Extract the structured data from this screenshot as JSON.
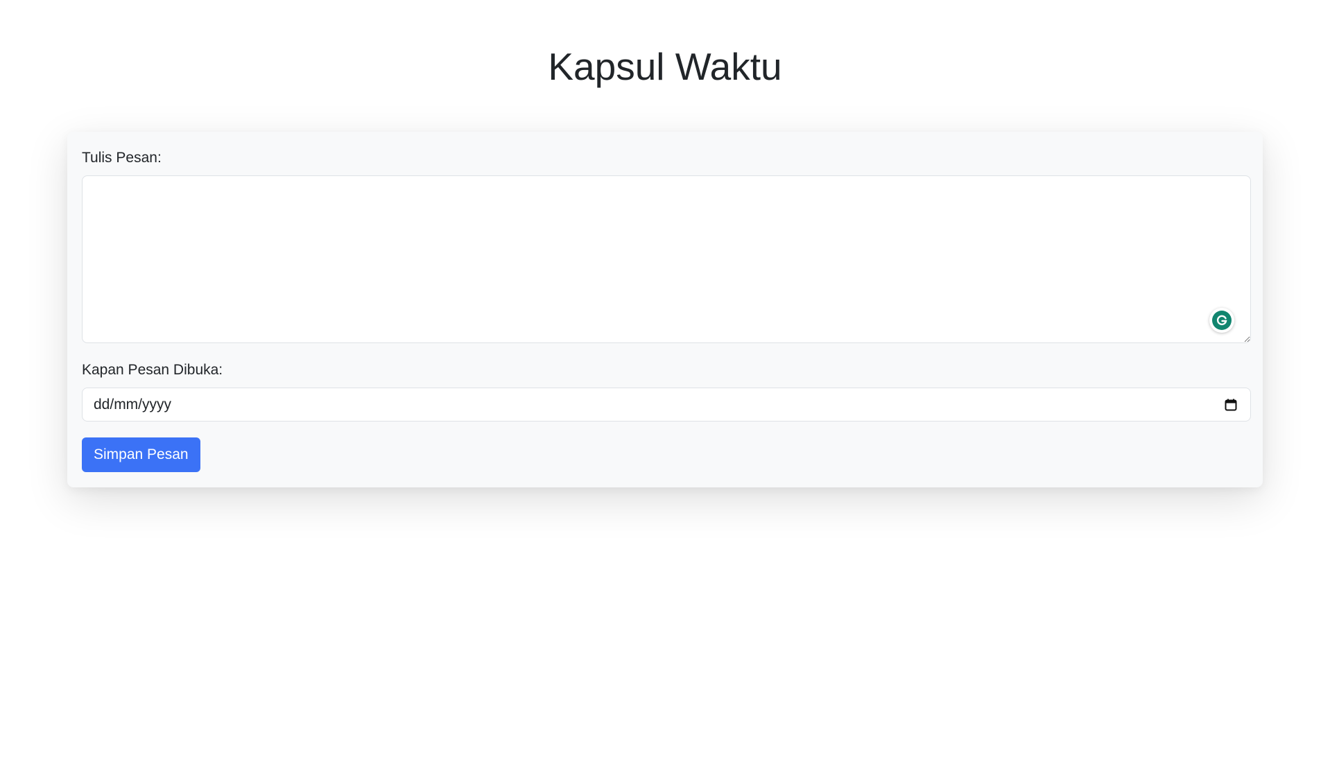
{
  "page": {
    "title": "Kapsul Waktu"
  },
  "form": {
    "message_label": "Tulis Pesan:",
    "message_value": "",
    "open_date_label": "Kapan Pesan Dibuka:",
    "open_date_placeholder": "dd/mm/yyyy",
    "save_button_label": "Simpan Pesan"
  },
  "icons": {
    "grammarly": "grammarly-icon",
    "calendar": "calendar-icon"
  },
  "colors": {
    "primary": "#3b72f6",
    "card_background": "#f8f9fa",
    "text": "#212529",
    "grammarly": "#11856f"
  }
}
